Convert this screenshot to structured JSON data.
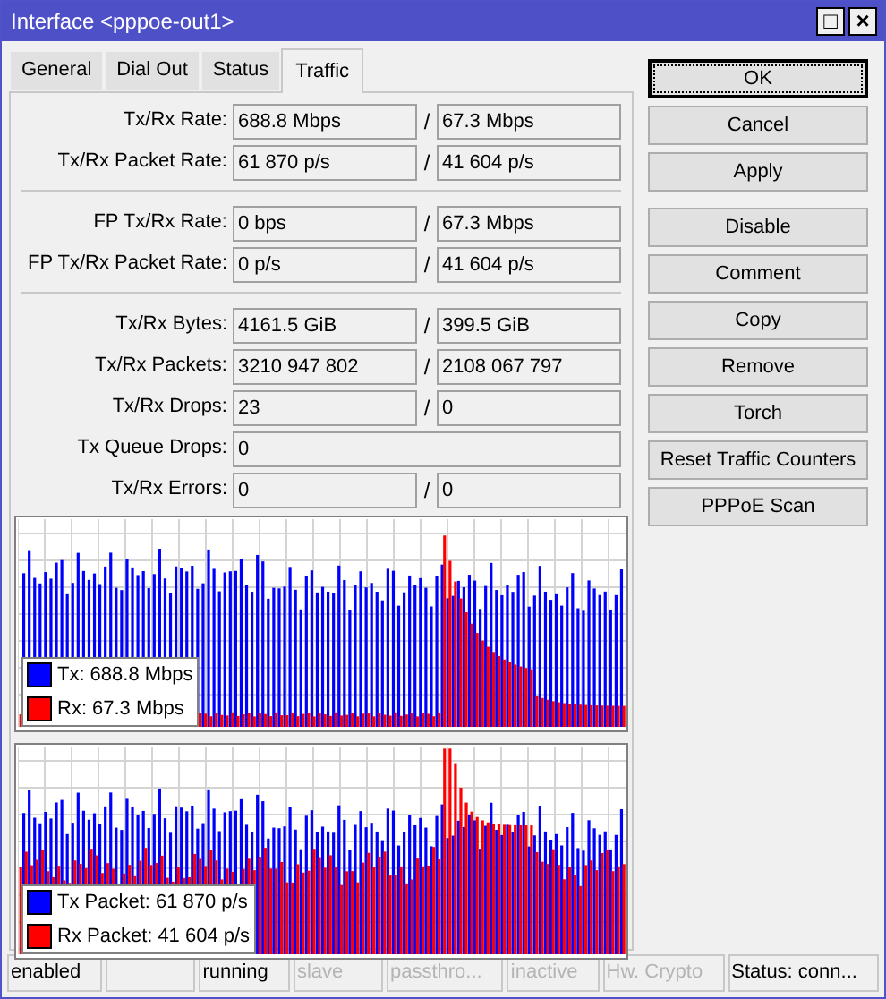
{
  "window": {
    "title": "Interface <pppoe-out1>",
    "controls": [
      "□",
      "×"
    ]
  },
  "tabs": [
    {
      "label": "General",
      "selected": false
    },
    {
      "label": "Dial Out",
      "selected": false
    },
    {
      "label": "Status",
      "selected": false
    },
    {
      "label": "Traffic",
      "selected": true
    }
  ],
  "sections": [
    {
      "rows": [
        {
          "kind": "pair",
          "label": "Tx/Rx Rate:",
          "tx": "688.8 Mbps",
          "rx": "67.3 Mbps"
        },
        {
          "kind": "pair",
          "label": "Tx/Rx Packet Rate:",
          "tx": "61 870 p/s",
          "rx": "41 604 p/s"
        }
      ]
    },
    {
      "rows": [
        {
          "kind": "pair",
          "label": "FP Tx/Rx Rate:",
          "tx": "0 bps",
          "rx": "67.3 Mbps"
        },
        {
          "kind": "pair",
          "label": "FP Tx/Rx Packet Rate:",
          "tx": "0 p/s",
          "rx": "41 604 p/s"
        }
      ]
    },
    {
      "rows": [
        {
          "kind": "pair",
          "label": "Tx/Rx Bytes:",
          "tx": "4161.5 GiB",
          "rx": "399.5 GiB"
        },
        {
          "kind": "pair",
          "label": "Tx/Rx Packets:",
          "tx": "3210 947 802",
          "rx": "2108 067 797"
        },
        {
          "kind": "pair",
          "label": "Tx/Rx Drops:",
          "tx": "23",
          "rx": "0"
        },
        {
          "kind": "single",
          "label": "Tx Queue Drops:",
          "value": "0"
        },
        {
          "kind": "pair",
          "label": "Tx/Rx Errors:",
          "tx": "0",
          "rx": "0"
        }
      ]
    }
  ],
  "separator": "/",
  "graphs": [
    {
      "kind": "rate",
      "legend": [
        {
          "label": "Tx:",
          "value": "688.8 Mbps",
          "color": "#0000ff"
        },
        {
          "label": "Rx:",
          "value": "67.3 Mbps",
          "color": "#ff0000"
        }
      ]
    },
    {
      "kind": "packets",
      "legend": [
        {
          "label": "Tx Packet:",
          "value": "61 870 p/s",
          "color": "#0000ff"
        },
        {
          "label": "Rx Packet:",
          "value": "41 604 p/s",
          "color": "#ff0000"
        }
      ]
    }
  ],
  "button_groups": [
    [
      {
        "label": "OK",
        "focused": true
      },
      {
        "label": "Cancel",
        "focused": false
      },
      {
        "label": "Apply",
        "focused": false
      }
    ],
    [
      {
        "label": "Disable",
        "focused": false
      },
      {
        "label": "Comment",
        "focused": false
      },
      {
        "label": "Copy",
        "focused": false
      },
      {
        "label": "Remove",
        "focused": false
      },
      {
        "label": "Torch",
        "focused": false
      },
      {
        "label": "Reset Traffic Counters",
        "focused": false
      },
      {
        "label": "PPPoE Scan",
        "focused": false
      }
    ]
  ],
  "status_bar": [
    {
      "kind": "text",
      "label": "enabled",
      "disabled": false
    },
    {
      "kind": "blank"
    },
    {
      "kind": "text",
      "label": "running",
      "disabled": false
    },
    {
      "kind": "text",
      "label": "slave",
      "disabled": true
    },
    {
      "kind": "text",
      "label": "passthro...",
      "disabled": true
    },
    {
      "kind": "text",
      "label": "inactive",
      "disabled": true
    },
    {
      "kind": "text",
      "label": "Hw. Crypto",
      "disabled": true
    },
    {
      "kind": "text",
      "label": "Status: conn...",
      "disabled": false
    }
  ]
}
